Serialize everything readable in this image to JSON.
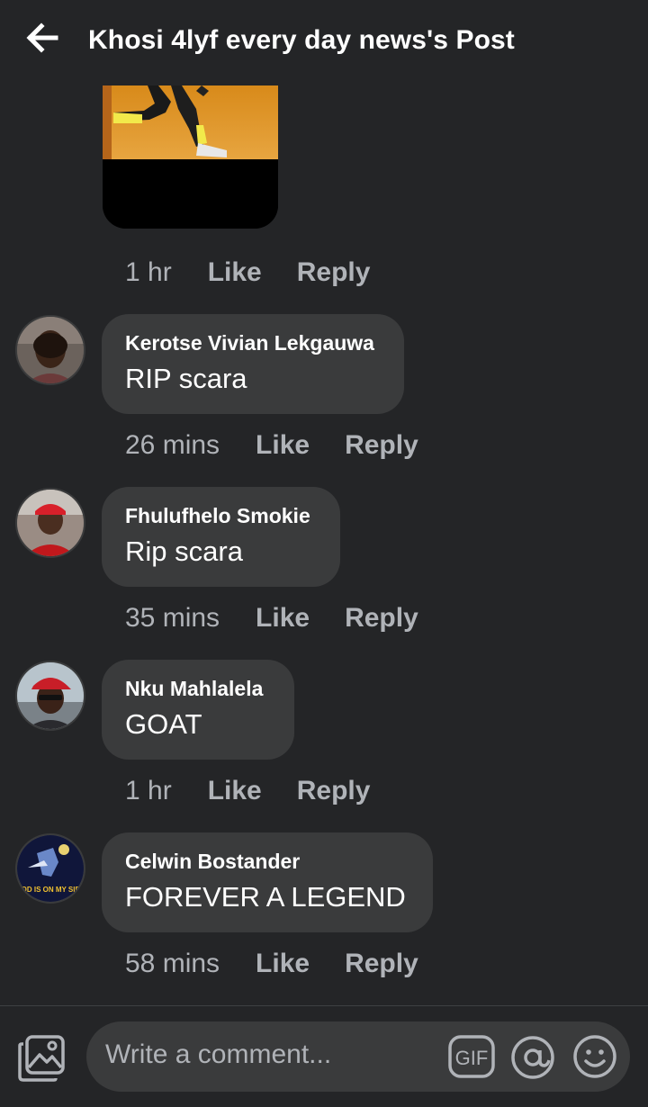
{
  "header": {
    "title": "Khosi 4lyf every day news's Post",
    "back_icon": "arrow-left-icon"
  },
  "media_comment": {
    "time": "1 hr",
    "like_label": "Like",
    "reply_label": "Reply"
  },
  "comments": [
    {
      "author": "Kerotse Vivian Lekgauwa",
      "text": "RIP scara",
      "time": "26 mins",
      "like_label": "Like",
      "reply_label": "Reply"
    },
    {
      "author": "Fhulufhelo Smokie",
      "text": "Rip scara",
      "time": "35 mins",
      "like_label": "Like",
      "reply_label": "Reply"
    },
    {
      "author": "Nku Mahlalela",
      "text": "GOAT",
      "time": "1 hr",
      "like_label": "Like",
      "reply_label": "Reply"
    },
    {
      "author": "Celwin Bostander",
      "text": "FOREVER A LEGEND",
      "time": "58 mins",
      "like_label": "Like",
      "reply_label": "Reply",
      "avatar_caption": "GOD IS ON MY SIDE"
    }
  ],
  "composer": {
    "placeholder": "Write a comment...",
    "gif_label": "GIF",
    "icons": [
      "photo-icon",
      "gif-icon",
      "at-icon",
      "emoji-icon"
    ]
  },
  "colors": {
    "background": "#242527",
    "bubble": "#3a3b3c",
    "secondary_text": "#b0b3b8",
    "primary_text": "#ffffff"
  }
}
